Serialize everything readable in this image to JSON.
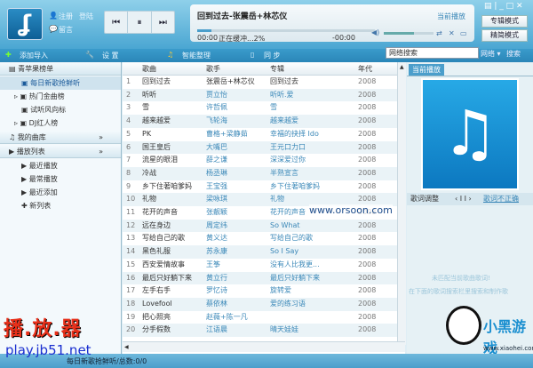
{
  "user": {
    "register": "注册",
    "login": "登陆",
    "message": "留言"
  },
  "player": {
    "title": "回到过去-张震岳+林芯仪",
    "current_time": "00:00",
    "buffer": "正在缓冲...2%",
    "remaining": "-00:00",
    "now_playing_link": "当前播放",
    "volume_fraction": 0.6,
    "progress_fraction": 0.08
  },
  "modes": {
    "album": "专辑模式",
    "simple": "精简模式"
  },
  "toolbar": {
    "add": "添加导入",
    "settings": "设 置",
    "smart": "智能整理",
    "sync": "同 步"
  },
  "search": {
    "value": "网络搜索",
    "scope": "网络",
    "button": "搜索"
  },
  "sidebar": {
    "section1": "青苹果榜单",
    "items1": [
      "每日新歌抢鲜听",
      "热门金曲榜",
      "试听风向标",
      "DJ红人榜"
    ],
    "section2": "我的曲库",
    "section3": "播放列表",
    "items3": [
      "最近播放",
      "最常播放",
      "最近添加"
    ],
    "new_list": "新列表"
  },
  "table": {
    "headers": [
      "歌曲",
      "歌手",
      "专辑",
      "年代"
    ],
    "rows": [
      [
        "1",
        "回到过去",
        "张震岳+林芯仪",
        "回到过去",
        "2008"
      ],
      [
        "2",
        "听听",
        "贾立怡",
        "听听.爱",
        "2008"
      ],
      [
        "3",
        "雪",
        "许哲佩",
        "雪",
        "2008"
      ],
      [
        "4",
        "越来越爱",
        "飞轮海",
        "越来越爱",
        "2008"
      ],
      [
        "5",
        "PK",
        "曹格+梁静茹",
        "幸福的抉择 Ido",
        "2008"
      ],
      [
        "6",
        "国王皇后",
        "大嘴巴",
        "王元口力口",
        "2008"
      ],
      [
        "7",
        "流星的眼泪",
        "薛之谦",
        "深深爱过你",
        "2008"
      ],
      [
        "8",
        "冷战",
        "杨丞琳",
        "半熟宣言",
        "2008"
      ],
      [
        "9",
        "乡下住著咱爹妈",
        "王宝强",
        "乡下住著咱爹妈",
        "2008"
      ],
      [
        "10",
        "礼物",
        "梁咏琪",
        "礼物",
        "2008"
      ],
      [
        "11",
        "花开的声音",
        "张靓颖",
        "花开的声音",
        "2008"
      ],
      [
        "12",
        "远在身边",
        "周定纬",
        "So What",
        "2008"
      ],
      [
        "13",
        "写给自己的歌",
        "黄义达",
        "写给自己的歌",
        "2008"
      ],
      [
        "14",
        "黑色礼服",
        "苏永康",
        "So I Say",
        "2008"
      ],
      [
        "15",
        "西安爱情故事",
        "王筝",
        "没有人比我更...",
        "2008"
      ],
      [
        "16",
        "最后只好躺下来",
        "黄立行",
        "最后只好躺下来",
        "2008"
      ],
      [
        "17",
        "左手右手",
        "罗忆诗",
        "旋转爱",
        "2008"
      ],
      [
        "18",
        "Lovefool",
        "蔡依林",
        "爱的练习语",
        "2008"
      ],
      [
        "19",
        "把心照亮",
        "赵薇+陈一凡",
        "",
        "2008"
      ],
      [
        "20",
        "分手假数",
        "江语晨",
        "晴天娃娃",
        "2008"
      ]
    ]
  },
  "right": {
    "tab": "当前播放",
    "lyric_adjust": "歌词调整",
    "lyric_wrong": "歌词不正确",
    "msg1": "未匹配当前歌曲歌词!",
    "msg2": "在下面的歌词搜索栏里搜索和制作歌"
  },
  "status": {
    "text": "每日新歌抢鲜听/总数:0/0"
  },
  "watermarks": {
    "site": "www.orsoon.com",
    "logo": "播.放.器",
    "logo_url": "play.jb51.net",
    "panda": "小黑游戏",
    "panda_url": "www.xiaohei.com"
  }
}
